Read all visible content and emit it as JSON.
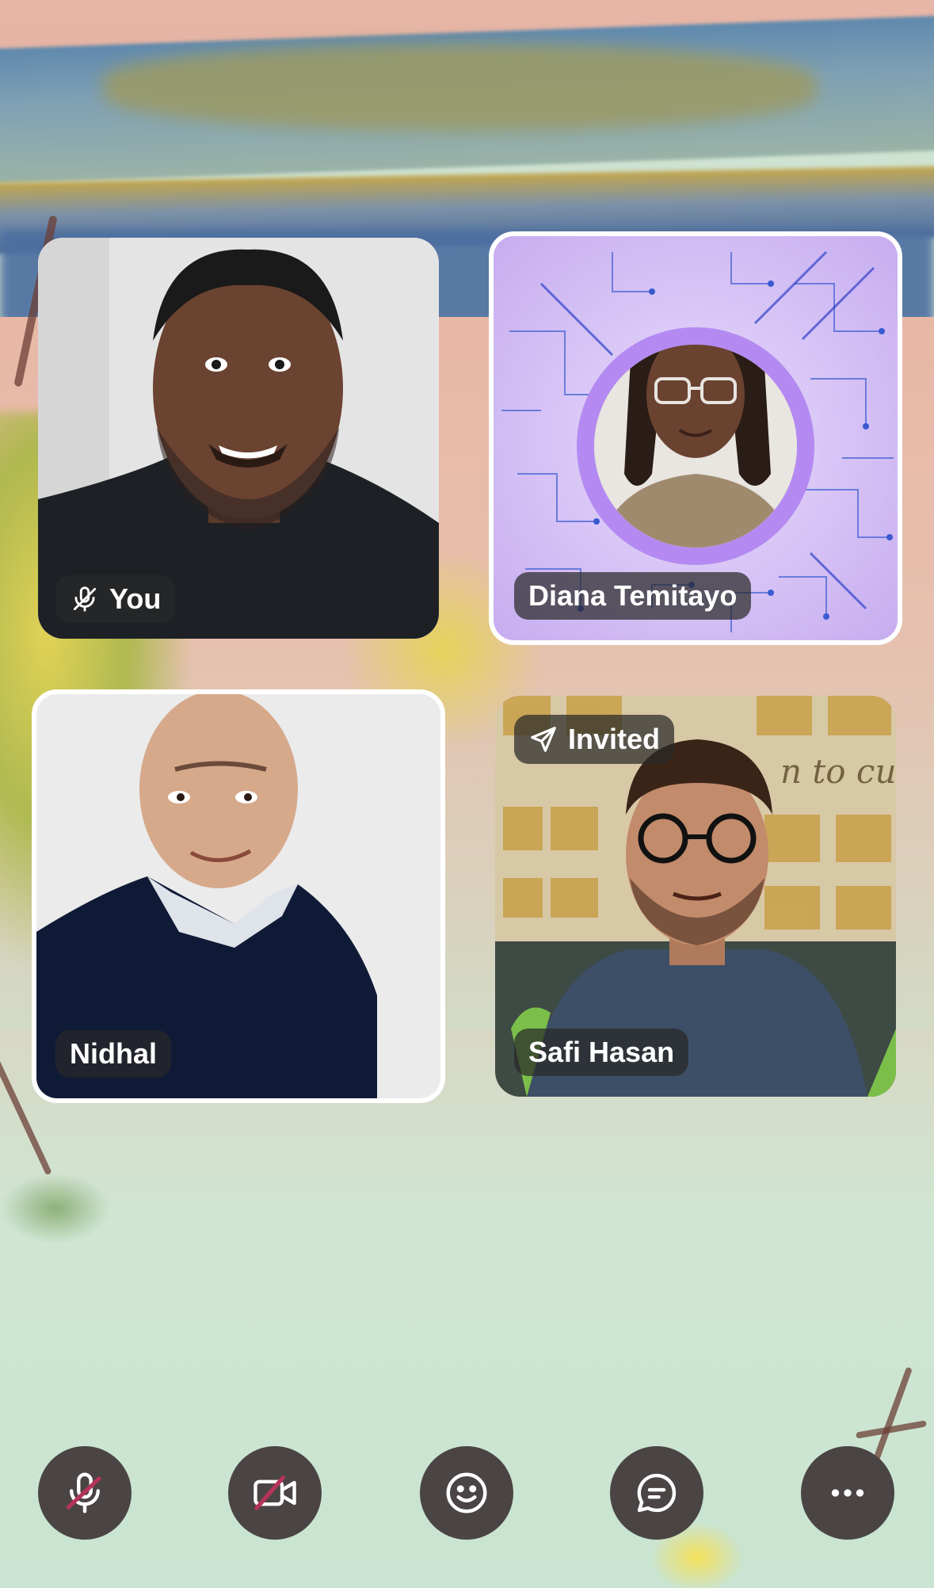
{
  "participants": [
    {
      "name": "You",
      "muted": true,
      "status": ""
    },
    {
      "name": "Diana Temitayo",
      "muted": false,
      "status": ""
    },
    {
      "name": "Nidhal",
      "muted": false,
      "status": ""
    },
    {
      "name": "Safi Hasan",
      "muted": false,
      "status": "Invited"
    }
  ],
  "controls": [
    {
      "icon": "microphone-muted-icon",
      "state": "off"
    },
    {
      "icon": "video-off-icon",
      "state": "off"
    },
    {
      "icon": "emoji-icon",
      "state": ""
    },
    {
      "icon": "chat-icon",
      "state": ""
    },
    {
      "icon": "more-icon",
      "state": ""
    }
  ],
  "colors": {
    "pill_bg": "#282828",
    "control_bg": "#4a4544",
    "mute_slash": "#b5335a",
    "diana_bg": "#d9c6f5",
    "diana_ring": "#b48af2"
  }
}
